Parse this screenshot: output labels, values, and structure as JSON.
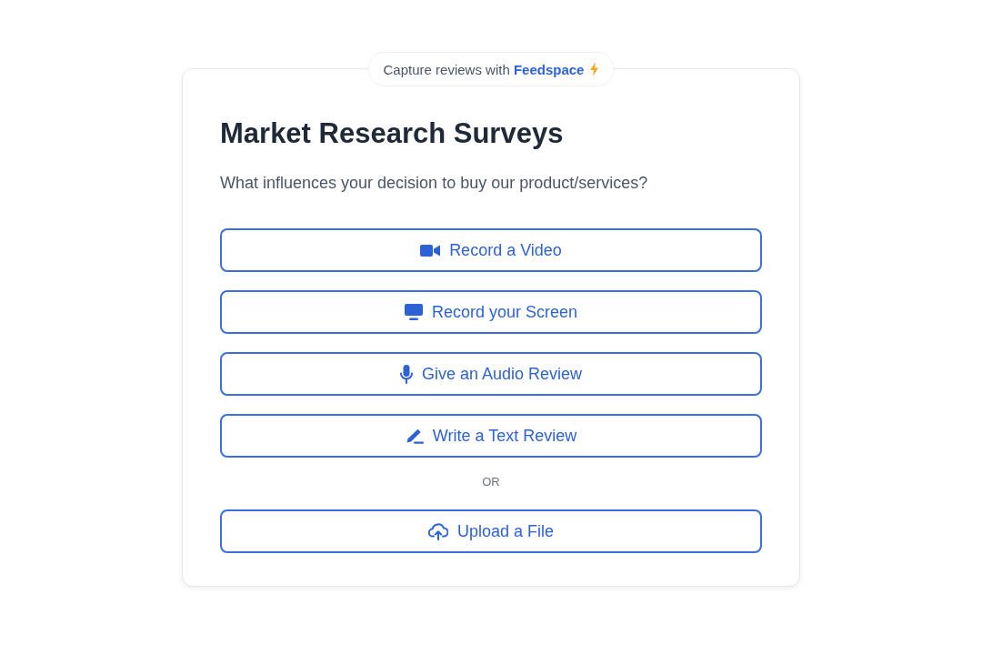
{
  "badge": {
    "text": "Capture reviews with **Feedspace**"
  },
  "title": "Market Research Surveys",
  "question": "What influences your decision to buy our product/services?",
  "options": [
    {
      "label": "Record a Video",
      "kind": "video"
    },
    {
      "label": "Record your Screen",
      "kind": "screen"
    },
    {
      "label": "Give an Audio Review",
      "kind": "audio"
    },
    {
      "label": "Write a Text Review",
      "kind": "text"
    }
  ],
  "divider": "OR",
  "upload": {
    "label": "Upload a File",
    "kind": "upload"
  }
}
